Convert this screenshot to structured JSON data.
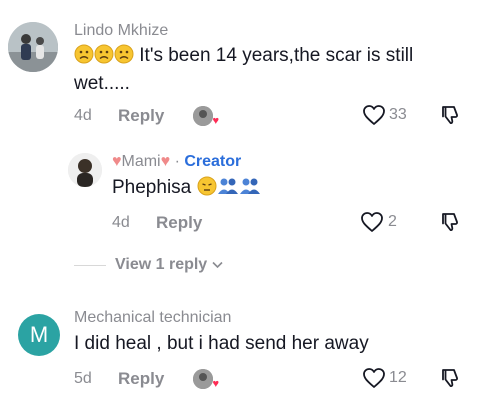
{
  "comments": [
    {
      "author": "Lindo Mkhize",
      "text": "It's been 14 years,the scar is still wet.....",
      "emoji_prefix": [
        "sad-face-icon",
        "sad-face-icon",
        "sad-face-icon"
      ],
      "age": "4d",
      "reply_label": "Reply",
      "likes": "33",
      "replies": [
        {
          "author": "Mami",
          "author_emoji": [
            "heart-icon",
            "heart-icon"
          ],
          "badge_separator": "·",
          "badge": "Creator",
          "text": "Phephisa",
          "emoji_suffix": [
            "pensive-face-icon",
            "two-people-icon",
            "two-people-icon"
          ],
          "age": "4d",
          "reply_label": "Reply",
          "likes": "2"
        }
      ],
      "view_replies": "View 1 reply"
    },
    {
      "author": "Mechanical technician",
      "avatar_letter": "M",
      "text": "I did heal , but i had send her away",
      "age": "5d",
      "reply_label": "Reply",
      "likes": "12"
    }
  ],
  "colors": {
    "accent": "#2b6edb",
    "avatar_teal": "#2ba3a3",
    "heart": "#fe2c55",
    "muted": "#8a8b91"
  }
}
